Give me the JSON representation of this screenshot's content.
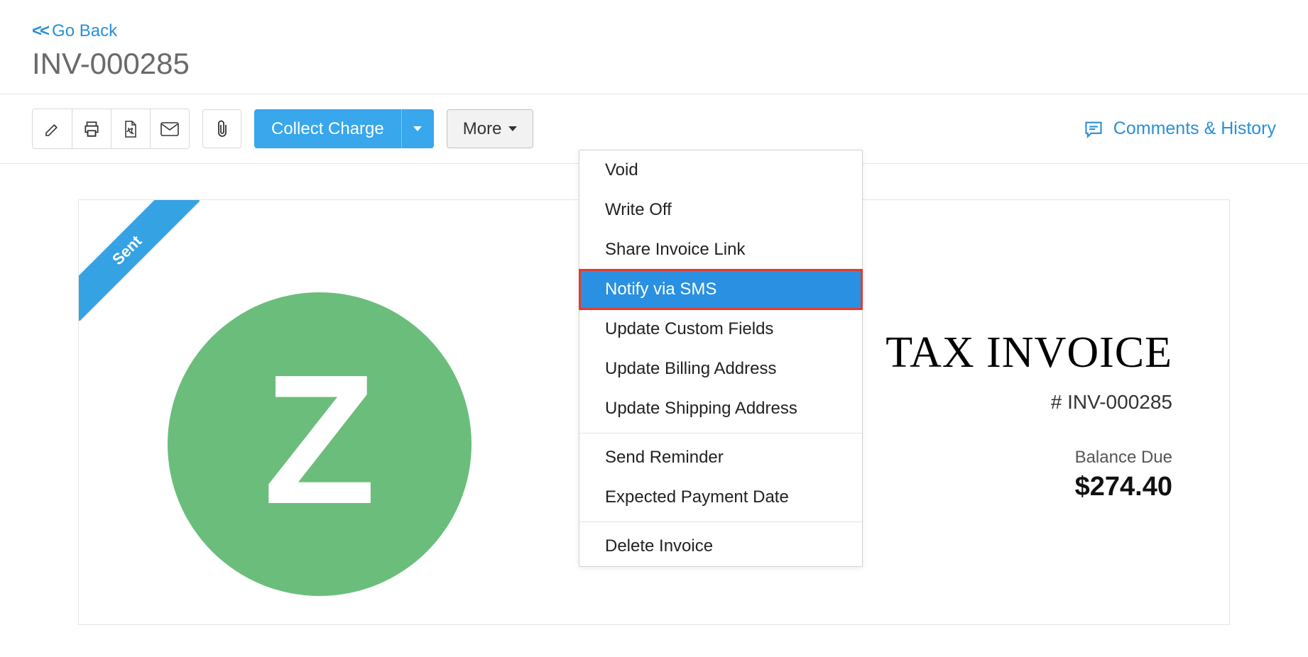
{
  "header": {
    "go_back": "Go Back",
    "title": "INV-000285"
  },
  "toolbar": {
    "collect_charge": "Collect Charge",
    "more": "More",
    "comments_history": "Comments & History"
  },
  "dropdown": {
    "items_a": [
      "Void",
      "Write Off",
      "Share Invoice Link",
      "Notify via SMS",
      "Update Custom Fields",
      "Update Billing Address",
      "Update Shipping Address"
    ],
    "items_b": [
      "Send Reminder",
      "Expected Payment Date"
    ],
    "items_c": [
      "Delete Invoice"
    ],
    "highlight_index": 3
  },
  "invoice": {
    "ribbon": "Sent",
    "tax_title": "TAX INVOICE",
    "number": "# INV-000285",
    "balance_label": "Balance Due",
    "balance_amount": "$274.40",
    "logo_letter": "Z"
  }
}
